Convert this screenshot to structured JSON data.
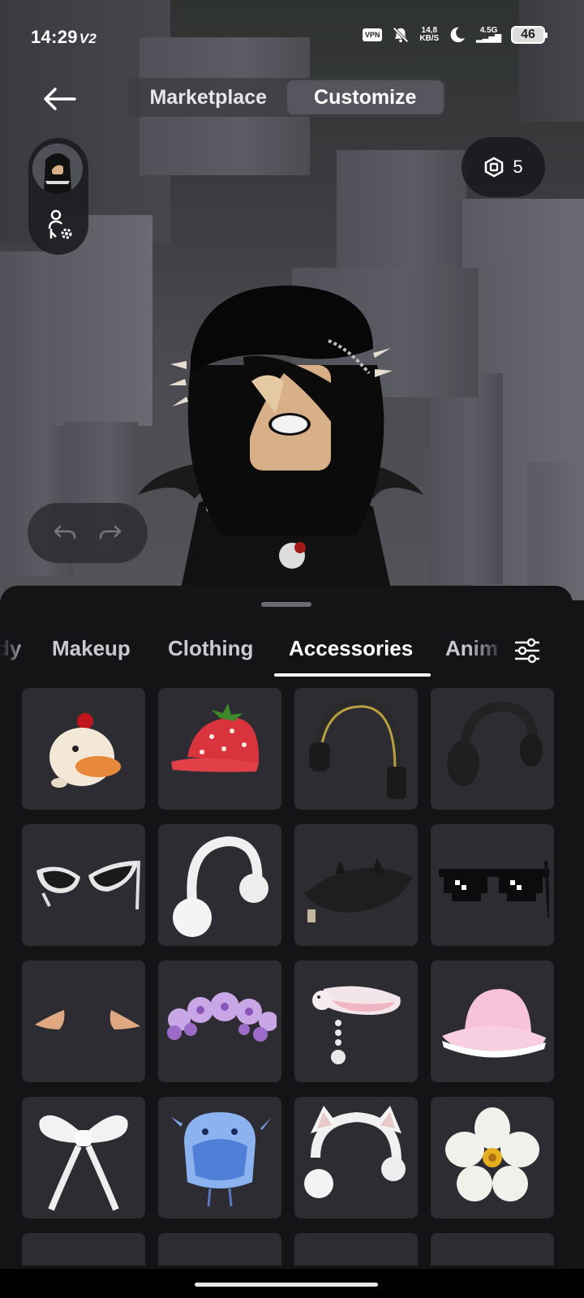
{
  "status_bar": {
    "time": "14:29",
    "carrier_tag": "V2",
    "vpn": "VPN",
    "speed_value": "14,8",
    "speed_unit": "KB/S",
    "network": "4.5G",
    "battery": "46"
  },
  "header": {
    "tabs": [
      {
        "label": "Marketplace",
        "active": false
      },
      {
        "label": "Customize",
        "active": true
      }
    ],
    "robux_balance": "5"
  },
  "category_tabs": [
    {
      "label": "dy",
      "active": false
    },
    {
      "label": "Makeup",
      "active": false
    },
    {
      "label": "Clothing",
      "active": false
    },
    {
      "label": "Accessories",
      "active": true
    },
    {
      "label": "Anim",
      "active": false
    }
  ],
  "items": [
    {
      "icon": "chicken-hat-icon"
    },
    {
      "icon": "strawberry-cap-icon"
    },
    {
      "icon": "gold-headphones-icon"
    },
    {
      "icon": "black-headphones-icon"
    },
    {
      "icon": "white-cat-eye-sunglasses-icon"
    },
    {
      "icon": "white-earmuffs-icon"
    },
    {
      "icon": "black-horned-hat-icon"
    },
    {
      "icon": "pixel-sunglasses-icon"
    },
    {
      "icon": "elf-ears-icon"
    },
    {
      "icon": "purple-flower-crown-icon"
    },
    {
      "icon": "pink-bow-headband-icon"
    },
    {
      "icon": "pink-bucket-hat-icon"
    },
    {
      "icon": "white-bow-icon"
    },
    {
      "icon": "blue-axolotl-hat-icon"
    },
    {
      "icon": "white-cat-ear-earmuffs-icon"
    },
    {
      "icon": "white-flower-icon"
    }
  ],
  "colors": {
    "sheet_bg": "#141417",
    "tile_bg": "#2c2c32",
    "accent": "#ffffff"
  }
}
